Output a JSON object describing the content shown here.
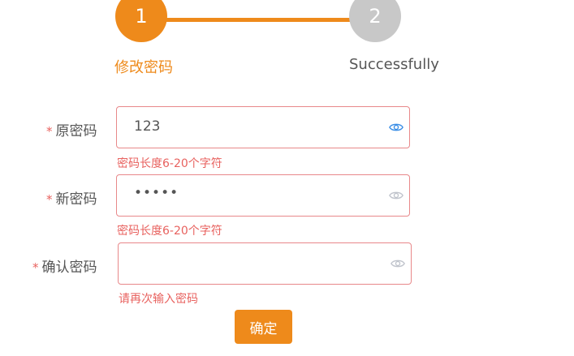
{
  "steps": [
    {
      "number": "1",
      "label": "修改密码",
      "color": "#ee8a1b"
    },
    {
      "number": "2",
      "label": "Successfully",
      "color": "#c8c8c8"
    }
  ],
  "form": {
    "required_mark": "*",
    "fields": [
      {
        "label": "原密码",
        "value": "123",
        "error": "密码长度6-20个字符",
        "eye_icon": "eye-icon",
        "eye_active": true
      },
      {
        "label": "新密码",
        "value": "•••••",
        "error": "密码长度6-20个字符",
        "eye_icon": "eye-icon",
        "eye_active": false
      },
      {
        "label": "确认密码",
        "value": "",
        "error": "请再次输入密码",
        "eye_icon": "eye-icon",
        "eye_active": false
      }
    ],
    "submit_label": "确定"
  },
  "colors": {
    "accent": "#ee8a1b",
    "inactive": "#c8c8c8",
    "error": "#e8625f",
    "eye_active": "#3a8ee6",
    "eye_inactive": "#c0c4cc"
  }
}
